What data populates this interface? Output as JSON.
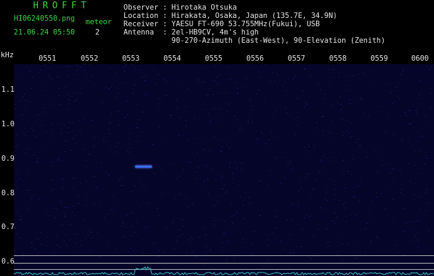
{
  "header": {
    "app_name": "HROFFT",
    "filename": "HI06240550.png",
    "datetime": "21.06.24 05:50",
    "meteor_label": "meteor",
    "meteor_count": "2",
    "observer": "Observer : Hirotaka Otsuka",
    "location": "Location : Hirakata, Osaka, Japan (135.7E, 34.9N)",
    "receiver": "Receiver : YAESU FT-690 53.755MHz(Fukui), USB",
    "antenna": "Antenna  : 2el-HB9CV, 4m's high",
    "antenna_line2": "           90-270-Azimuth (East-West), 90-Elevation (Zenith)"
  },
  "spectrogram": {
    "y_unit": "kHz",
    "x_ticks": [
      "0551",
      "0552",
      "0553",
      "0554",
      "0555",
      "0556",
      "0557",
      "0558",
      "0559",
      "0600"
    ],
    "y_ticks": [
      "1.1",
      "1.0",
      "0.9",
      "0.8",
      "0.7",
      "0.6"
    ],
    "colors": {
      "background": "#05052a",
      "noise": "#1a1a6a",
      "meteor": "#3b6dff",
      "level": "#32c8c8",
      "text_green": "#39d93a",
      "text_white": "#e6e6e6"
    }
  }
}
